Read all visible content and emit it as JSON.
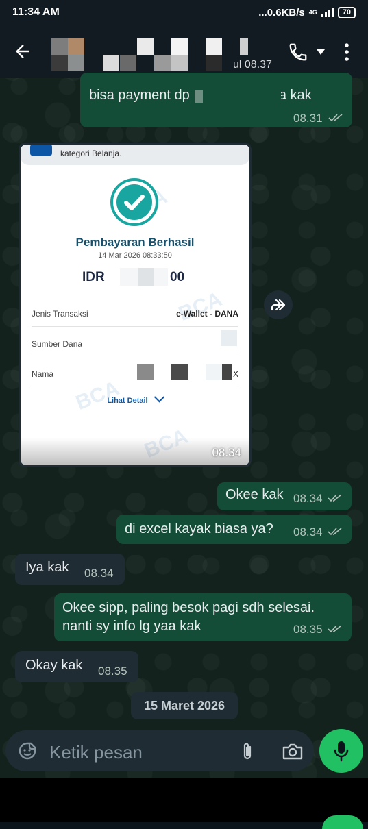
{
  "status_bar": {
    "time": "11:34 AM",
    "network_speed": "...0.6KB/s",
    "network_type": "4G",
    "battery": "70"
  },
  "header": {
    "last_seen_fragment": "ul 08.37",
    "icons": [
      "back-arrow-icon",
      "phone-icon",
      "caret-down-icon",
      "more-vert-icon"
    ]
  },
  "messages": [
    {
      "id": "m1",
      "direction": "out",
      "text": "bisa payment dp          no ini yaa kak",
      "time": "08.31",
      "ticks": "read"
    },
    {
      "id": "m2",
      "direction": "in",
      "type": "image",
      "time": "08.34"
    },
    {
      "id": "m3",
      "direction": "out",
      "text": "Okee kak",
      "time": "08.34",
      "ticks": "read"
    },
    {
      "id": "m4",
      "direction": "out",
      "text": "di excel kayak biasa ya?",
      "time": "08.34",
      "ticks": "read"
    },
    {
      "id": "m5",
      "direction": "in",
      "text": "Iya kak",
      "time": "08.34"
    },
    {
      "id": "m6",
      "direction": "out",
      "text_line1": "Okee sipp, paling besok pagi sdh selesai.",
      "text_line2": "nanti sy info lg yaa kak",
      "time": "08.35",
      "ticks": "read"
    },
    {
      "id": "m7",
      "direction": "in",
      "text": "Okay kak",
      "time": "08.35"
    }
  ],
  "receipt": {
    "notification_text": "kategori Belanja.",
    "watermark": "BCA",
    "title": "Pembayaran Berhasil",
    "datetime": "14 Mar 2026 08:33:50",
    "amount_prefix": "IDR",
    "amount_suffix": "00",
    "rows": [
      {
        "label": "Jenis Transaksi",
        "value": "e-Wallet - DANA"
      },
      {
        "label": "Sumber Dana",
        "value": ""
      },
      {
        "label": "Nama",
        "value": "X"
      }
    ],
    "detail_link": "Lihat Detail"
  },
  "date_divider": "15 Maret 2026",
  "composer": {
    "placeholder": "Ketik pesan"
  },
  "colors": {
    "bubble_out": "#144d37",
    "bubble_in": "#1f2c34",
    "mic_button": "#21c063",
    "background": "#13221c"
  }
}
